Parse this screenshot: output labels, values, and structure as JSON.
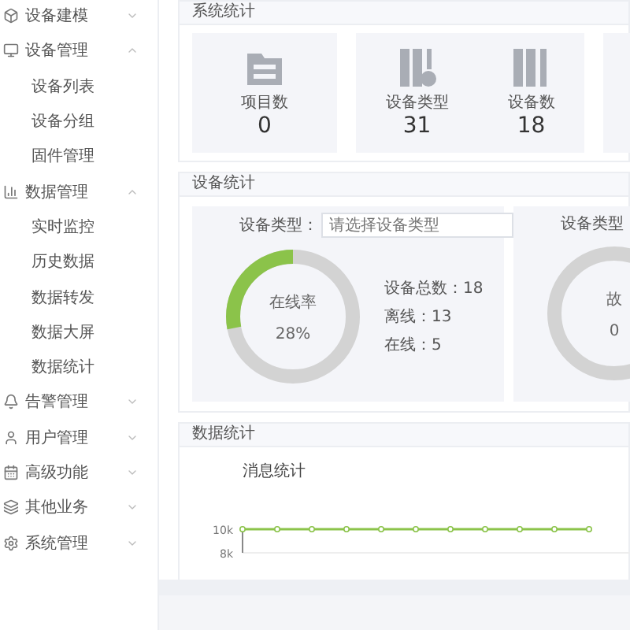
{
  "sidebar": {
    "items": [
      {
        "label": "设备建模",
        "expanded": false
      },
      {
        "label": "设备管理",
        "expanded": true,
        "children": [
          {
            "label": "设备列表"
          },
          {
            "label": "设备分组"
          },
          {
            "label": "固件管理"
          }
        ]
      },
      {
        "label": "数据管理",
        "expanded": true,
        "children": [
          {
            "label": "实时监控"
          },
          {
            "label": "历史数据"
          },
          {
            "label": "数据转发"
          },
          {
            "label": "数据大屏"
          },
          {
            "label": "数据统计"
          }
        ]
      },
      {
        "label": "告警管理",
        "expanded": false
      },
      {
        "label": "用户管理",
        "expanded": false
      },
      {
        "label": "高级功能",
        "expanded": false
      },
      {
        "label": "其他业务",
        "expanded": false
      },
      {
        "label": "系统管理",
        "expanded": false
      }
    ]
  },
  "system_stats": {
    "title": "系统统计",
    "cards": [
      {
        "items": [
          {
            "label": "项目数",
            "value": "0",
            "kind": "folder"
          }
        ]
      },
      {
        "items": [
          {
            "label": "设备类型",
            "value": "31",
            "kind": "type"
          },
          {
            "label": "设备数",
            "value": "18",
            "kind": "device"
          }
        ]
      }
    ]
  },
  "device_stats": {
    "title": "设备统计",
    "panels": [
      {
        "filter_label": "设备类型：",
        "placeholder": "请选择设备类型",
        "center_label": "在线率",
        "center_value": "28%",
        "level": 0.28,
        "legend": [
          "设备总数：18",
          "离线：13",
          "在线：5"
        ]
      },
      {
        "filter_label": "设备类型",
        "center_label": "故",
        "center_value": "0"
      }
    ]
  },
  "data_stats": {
    "title": "数据统计",
    "chart_title": "消息统计",
    "chart_data": {
      "type": "line",
      "ylim": [
        8000,
        10000
      ],
      "yticks": [
        {
          "value": 8000,
          "label": "8k"
        },
        {
          "value": 10000,
          "label": "10k"
        }
      ],
      "series": [
        {
          "color": "#8bc34a",
          "marker": "circle",
          "values": [
            10000,
            10000,
            10000,
            10000,
            10000,
            10000,
            10000,
            10000,
            10000,
            10000,
            10000
          ]
        }
      ]
    }
  }
}
